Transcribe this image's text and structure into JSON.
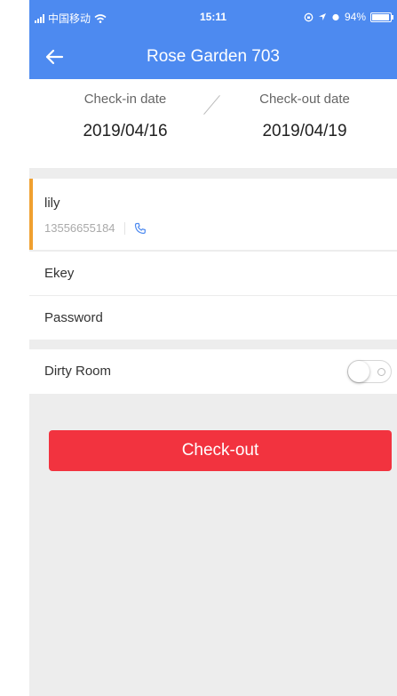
{
  "status_bar": {
    "carrier": "中国移动",
    "time": "15:11",
    "battery": "94%"
  },
  "nav": {
    "title": "Rose Garden 703",
    "back_icon": "arrow-left-icon"
  },
  "dates": {
    "checkin_label": "Check-in date",
    "checkin_value": "2019/04/16",
    "checkout_label": "Check-out date",
    "checkout_value": "2019/04/19"
  },
  "guest": {
    "name": "lily",
    "phone": "13556655184",
    "phone_icon": "phone-icon"
  },
  "rows": {
    "ekey_label": "Ekey",
    "password_label": "Password",
    "dirty_room_label": "Dirty Room",
    "dirty_room_on": false
  },
  "actions": {
    "checkout_label": "Check-out"
  },
  "colors": {
    "header": "#4d8af0",
    "accent_bar": "#f0a030",
    "checkout_button": "#f2333f",
    "background": "#ededed"
  }
}
